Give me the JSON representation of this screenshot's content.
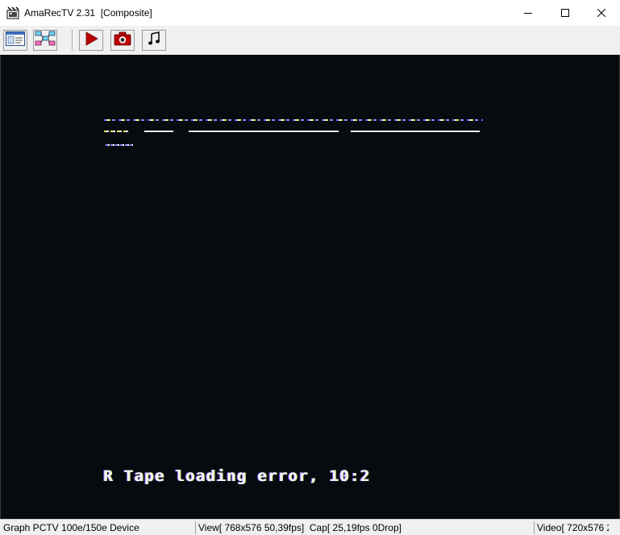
{
  "window": {
    "title": "AmaRecTV 2.31  [Composite]",
    "controls": {
      "minimize_icon": "minimize-icon",
      "maximize_icon": "maximize-icon",
      "close_icon": "close-icon"
    }
  },
  "toolbar": {
    "buttons": [
      {
        "name": "view-settings-button",
        "icon": "window-settings-icon"
      },
      {
        "name": "graph-button",
        "icon": "graph-icon"
      },
      {
        "name": "record-button",
        "icon": "play-record-icon",
        "color": "#c00000"
      },
      {
        "name": "capture-button",
        "icon": "camera-icon",
        "color": "#c00000"
      },
      {
        "name": "audio-button",
        "icon": "music-note-icon"
      }
    ]
  },
  "video": {
    "background": "#070b10",
    "message": "R Tape loading error, 10:2"
  },
  "statusbar": {
    "graph": "Graph PCTV 100e/150e Device",
    "view": "View[ 768x576 50,39fps]  Cap[ 25,19fps 0Drop]",
    "video": "Video[ 720x576 25"
  }
}
